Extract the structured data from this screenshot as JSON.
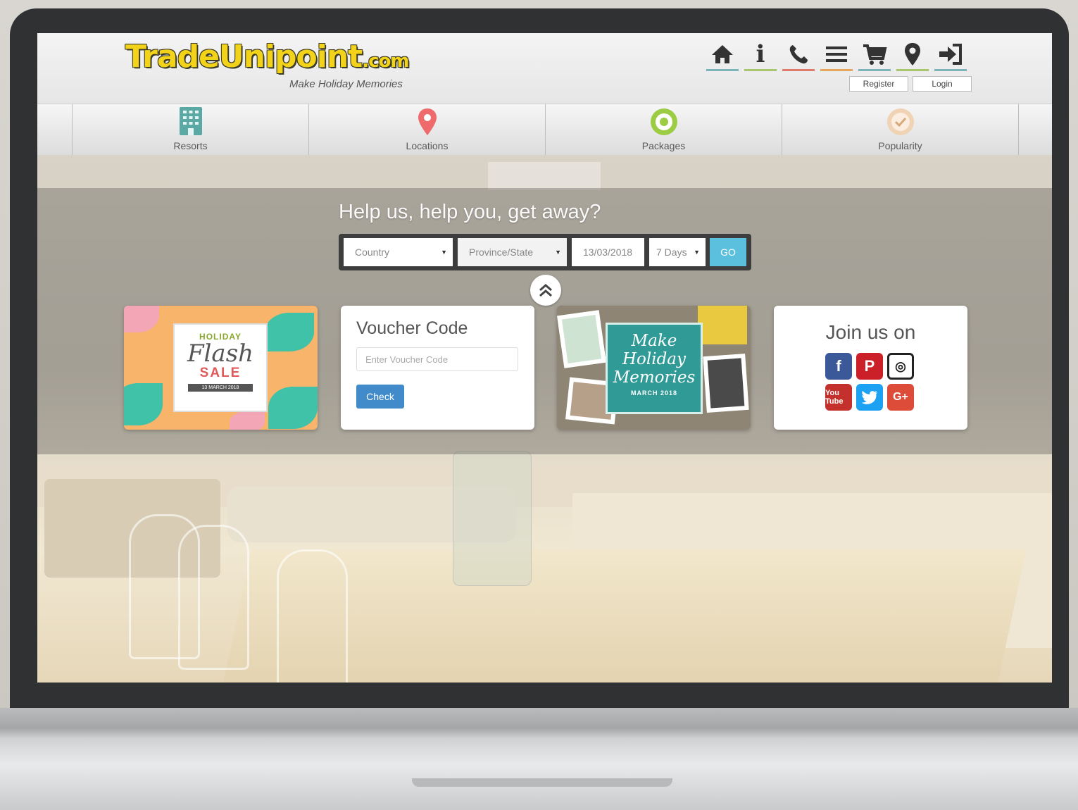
{
  "header": {
    "logo_main": "TradeUnipoint",
    "logo_suffix": ".com",
    "tagline": "Make Holiday Memories",
    "icons": [
      "home-icon",
      "info-icon",
      "phone-icon",
      "menu-icon",
      "cart-icon",
      "map-pin-icon",
      "sign-in-icon"
    ],
    "register_label": "Register",
    "login_label": "Login"
  },
  "nav": {
    "items": [
      {
        "label": "Resorts",
        "icon": "building-icon"
      },
      {
        "label": "Locations",
        "icon": "map-pin-icon"
      },
      {
        "label": "Packages",
        "icon": "target-icon"
      },
      {
        "label": "Popularity",
        "icon": "check-circle-icon"
      }
    ]
  },
  "search": {
    "headline": "Help us, help you, get away?",
    "country": "Country",
    "province": "Province/State",
    "date": "13/03/2018",
    "duration": "7 Days",
    "go_label": "GO"
  },
  "promo_flash": {
    "line1": "HOLIDAY",
    "line2": "Flash",
    "line3": "SALE",
    "date": "13 MARCH 2018"
  },
  "voucher": {
    "title": "Voucher Code",
    "placeholder": "Enter Voucher Code",
    "check_label": "Check"
  },
  "promo_memories": {
    "text": "Make Holiday Memories",
    "date": "MARCH 2018"
  },
  "social": {
    "title": "Join us on",
    "icons": [
      "facebook-icon",
      "pinterest-icon",
      "instagram-icon",
      "youtube-icon",
      "twitter-icon",
      "google-plus-icon"
    ],
    "youtube_text": "You Tube",
    "gplus_text": "G+"
  },
  "colors": {
    "logo_yellow": "#f2d319",
    "go_button": "#5bc0de",
    "check_button": "#428bca",
    "memories_teal": "#2f9a96",
    "flash_orange": "#f7b46a"
  }
}
